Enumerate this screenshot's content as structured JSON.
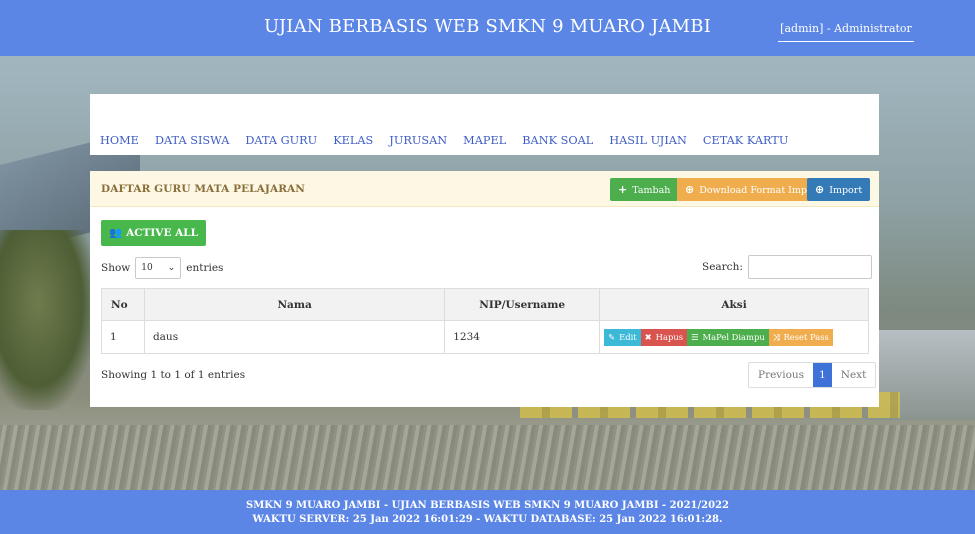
{
  "header": {
    "title": "UJIAN BERBASIS WEB SMKN 9 MUARO JAMBI",
    "user": "[admin] - Administrator"
  },
  "nav": {
    "items": [
      "HOME",
      "DATA SISWA",
      "DATA GURU",
      "KELAS",
      "JURUSAN",
      "MAPEL",
      "BANK SOAL",
      "HASIL UJIAN",
      "CETAK KARTU"
    ]
  },
  "panel": {
    "title": "DAFTAR GURU MATA PELAJARAN",
    "buttons": {
      "tambah": "Tambah",
      "download": "Download Format Import",
      "import": "Import"
    },
    "active_all": "ACTIVE ALL",
    "show_label": "Show",
    "entries_value": "10",
    "entries_label": "entries",
    "search_label": "Search:",
    "search_value": ""
  },
  "table": {
    "headers": [
      "No",
      "Nama",
      "NIP/Username",
      "Aksi"
    ],
    "rows": [
      {
        "no": "1",
        "nama": "daus",
        "nip": "1234"
      }
    ],
    "actions": {
      "edit": "Edit",
      "hapus": "Hapus",
      "mapel": "MaPel Diampu",
      "reset": "Reset Pass"
    }
  },
  "pagination": {
    "info": "Showing 1 to 1 of 1 entries",
    "previous": "Previous",
    "current": "1",
    "next": "Next"
  },
  "footer": {
    "line1": "SMKN 9 MUARO JAMBI - UJIAN BERBASIS WEB SMKN 9 MUARO JAMBI - 2021/2022",
    "line2": "WAKTU SERVER: 25 Jan 2022 16:01:29 - WAKTU DATABASE: 25 Jan 2022 16:01:28."
  },
  "colors": {
    "topbar": "#5b86e5",
    "nav_link": "#3f5ec4",
    "panel_head": "#fcf8e3",
    "success": "#4cae4c",
    "warning": "#f0ad4e",
    "primary": "#337ab7",
    "danger": "#d9534f",
    "info": "#3bb9d7"
  },
  "icons": {
    "tambah": "plus-icon",
    "download": "circle-plus-icon",
    "import": "circle-plus-icon",
    "active_all": "users-icon",
    "edit": "pencil-icon",
    "hapus": "close-icon",
    "mapel": "list-icon",
    "reset": "shuffle-icon"
  }
}
